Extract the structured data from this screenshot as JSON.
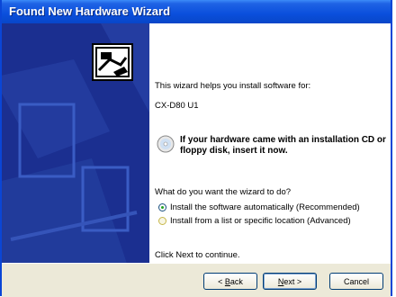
{
  "window": {
    "title": "Found New Hardware Wizard",
    "accent_color": "#0a4fdc"
  },
  "content": {
    "intro": "This wizard helps you install software for:",
    "device_name": "CX-D80 U1",
    "cd_prompt": "If your hardware came with an installation CD or floppy disk, insert it now.",
    "question": "What do you want the wizard to do?",
    "options": [
      {
        "label": "Install the software automatically (Recommended)",
        "checked": true
      },
      {
        "label": "Install from a list or specific location (Advanced)",
        "checked": false
      }
    ],
    "continue_text": "Click Next to continue."
  },
  "buttons": {
    "back_prefix": "< ",
    "back_key": "B",
    "back_rest": "ack",
    "next_key": "N",
    "next_rest": "ext >",
    "cancel": "Cancel"
  },
  "icons": [
    "hardware-wizard-icon",
    "cd-icon"
  ]
}
